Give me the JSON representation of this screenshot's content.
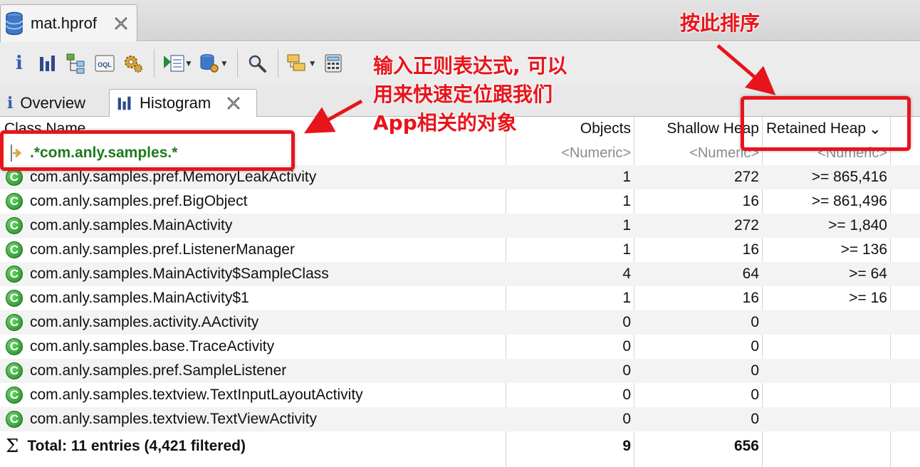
{
  "editor": {
    "tab_label": "mat.hprof"
  },
  "toolbar": {
    "buttons": [
      "info-icon",
      "histogram-icon",
      "dominator-tree-icon",
      "oql-icon",
      "gear-icon",
      "run-report-icon",
      "query-browser-icon",
      "search-icon",
      "group-icon",
      "calculator-icon"
    ]
  },
  "view_tabs": [
    {
      "label": "Overview"
    },
    {
      "label": "Histogram"
    }
  ],
  "table": {
    "columns": [
      "Class Name",
      "Objects",
      "Shallow Heap",
      "Retained Heap"
    ],
    "sort_indicator": "⌄",
    "filter": {
      "regex": ".*com.anly.samples.*",
      "numeric_placeholder": "<Numeric>"
    },
    "rows": [
      {
        "name": "com.anly.samples.pref.MemoryLeakActivity",
        "objects": "1",
        "shallow": "272",
        "retained": ">= 865,416"
      },
      {
        "name": "com.anly.samples.pref.BigObject",
        "objects": "1",
        "shallow": "16",
        "retained": ">= 861,496"
      },
      {
        "name": "com.anly.samples.MainActivity",
        "objects": "1",
        "shallow": "272",
        "retained": ">= 1,840"
      },
      {
        "name": "com.anly.samples.pref.ListenerManager",
        "objects": "1",
        "shallow": "16",
        "retained": ">= 136"
      },
      {
        "name": "com.anly.samples.MainActivity$SampleClass",
        "objects": "4",
        "shallow": "64",
        "retained": ">= 64"
      },
      {
        "name": "com.anly.samples.MainActivity$1",
        "objects": "1",
        "shallow": "16",
        "retained": ">= 16"
      },
      {
        "name": "com.anly.samples.activity.AActivity",
        "objects": "0",
        "shallow": "0",
        "retained": ""
      },
      {
        "name": "com.anly.samples.base.TraceActivity",
        "objects": "0",
        "shallow": "0",
        "retained": ""
      },
      {
        "name": "com.anly.samples.pref.SampleListener",
        "objects": "0",
        "shallow": "0",
        "retained": ""
      },
      {
        "name": "com.anly.samples.textview.TextInputLayoutActivity",
        "objects": "0",
        "shallow": "0",
        "retained": ""
      },
      {
        "name": "com.anly.samples.textview.TextViewActivity",
        "objects": "0",
        "shallow": "0",
        "retained": ""
      }
    ],
    "total": {
      "label": "Total: 11 entries (4,421 filtered)",
      "objects": "9",
      "shallow": "656"
    }
  },
  "annotations": {
    "sort_note": "按此排序",
    "regex_note_lines": [
      "输入正则表达式, 可以",
      "用来快速定位跟我们",
      "App相关的对象"
    ],
    "color": "#e8141b"
  }
}
